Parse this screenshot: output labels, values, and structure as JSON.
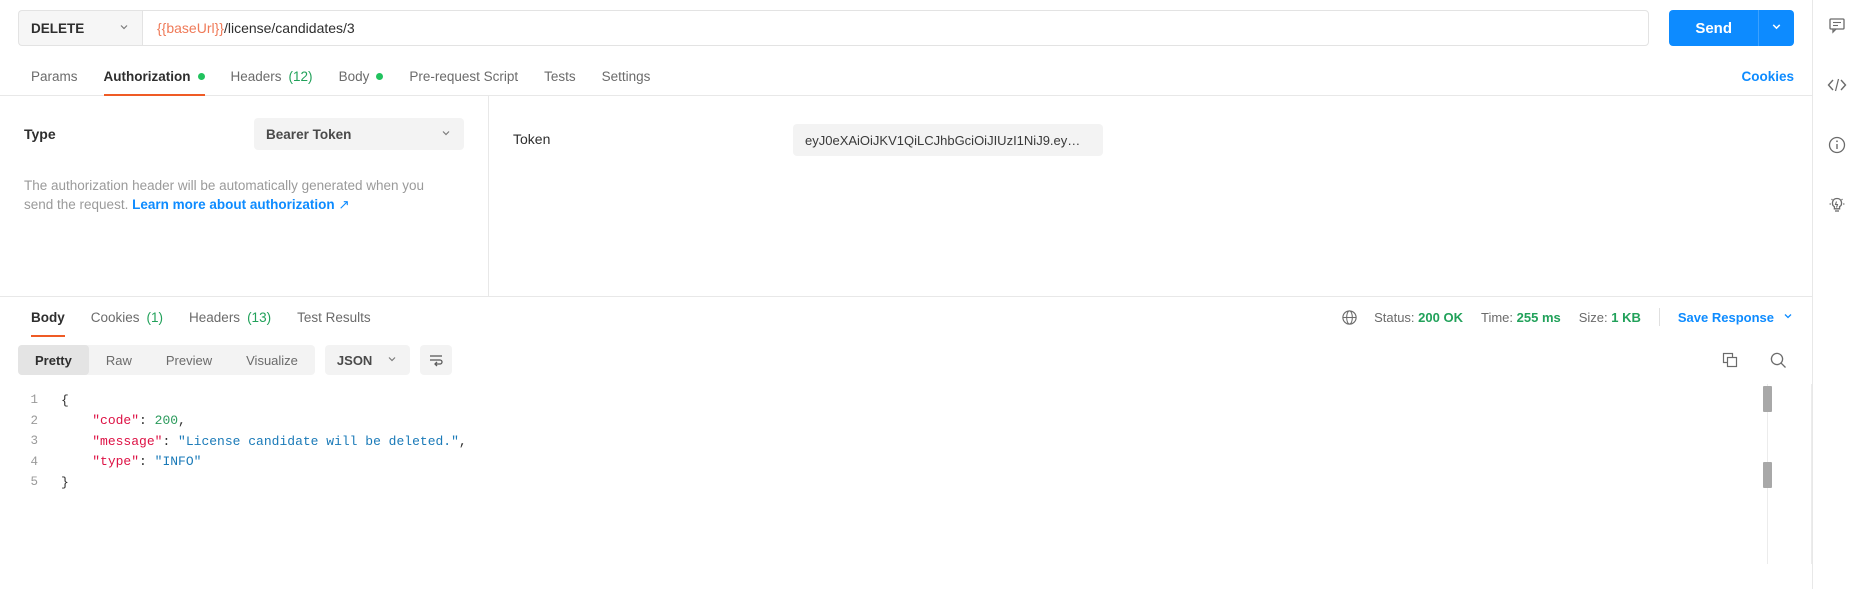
{
  "request": {
    "method": "DELETE",
    "url_variable": "{{baseUrl}}",
    "url_path": "/license/candidates/3",
    "send_label": "Send",
    "send_caret_icon": "chevron-down-icon",
    "method_caret_icon": "chevron-down-icon"
  },
  "request_tabs": {
    "items": [
      {
        "label": "Params",
        "active": false,
        "dot": false,
        "count": ""
      },
      {
        "label": "Authorization",
        "active": true,
        "dot": true,
        "count": ""
      },
      {
        "label": "Headers",
        "active": false,
        "dot": false,
        "count": "(12)"
      },
      {
        "label": "Body",
        "active": false,
        "dot": true,
        "count": ""
      },
      {
        "label": "Pre-request Script",
        "active": false,
        "dot": false,
        "count": ""
      },
      {
        "label": "Tests",
        "active": false,
        "dot": false,
        "count": ""
      },
      {
        "label": "Settings",
        "active": false,
        "dot": false,
        "count": ""
      }
    ],
    "cookies_link": "Cookies"
  },
  "authorization": {
    "type_label": "Type",
    "type_value": "Bearer Token",
    "type_caret_icon": "chevron-down-icon",
    "help_text": "The authorization header will be automatically generated when you send the request.",
    "help_link": "Learn more about authorization",
    "help_link_icon": "external-link-icon",
    "token_label": "Token",
    "token_value": "eyJ0eXAiOiJKV1QiLCJhbGciOiJIUzI1NiJ9.ey…"
  },
  "response_tabs": {
    "items": [
      {
        "label": "Body",
        "active": true,
        "count": ""
      },
      {
        "label": "Cookies",
        "active": false,
        "count": "(1)"
      },
      {
        "label": "Headers",
        "active": false,
        "count": "(13)"
      },
      {
        "label": "Test Results",
        "active": false,
        "count": ""
      }
    ],
    "globe_icon": "globe-icon",
    "status_label": "Status:",
    "status_value": "200 OK",
    "time_label": "Time:",
    "time_value": "255 ms",
    "size_label": "Size:",
    "size_value": "1 KB",
    "save_response_label": "Save Response",
    "save_response_caret_icon": "chevron-down-icon"
  },
  "body_toolbar": {
    "views": [
      {
        "label": "Pretty",
        "active": true
      },
      {
        "label": "Raw",
        "active": false
      },
      {
        "label": "Preview",
        "active": false
      },
      {
        "label": "Visualize",
        "active": false
      }
    ],
    "format": "JSON",
    "format_caret_icon": "chevron-down-icon",
    "wrap_icon": "word-wrap-icon",
    "copy_icon": "copy-icon",
    "search_icon": "search-icon"
  },
  "response_body": {
    "lines": [
      {
        "num": "1",
        "tokens": [
          {
            "t": "p",
            "v": "{"
          }
        ]
      },
      {
        "num": "2",
        "tokens": [
          {
            "t": "p",
            "v": "    "
          },
          {
            "t": "k",
            "v": "\"code\""
          },
          {
            "t": "p",
            "v": ": "
          },
          {
            "t": "n",
            "v": "200"
          },
          {
            "t": "p",
            "v": ","
          }
        ]
      },
      {
        "num": "3",
        "tokens": [
          {
            "t": "p",
            "v": "    "
          },
          {
            "t": "k",
            "v": "\"message\""
          },
          {
            "t": "p",
            "v": ": "
          },
          {
            "t": "s",
            "v": "\"License candidate will be deleted.\""
          },
          {
            "t": "p",
            "v": ","
          }
        ]
      },
      {
        "num": "4",
        "tokens": [
          {
            "t": "p",
            "v": "    "
          },
          {
            "t": "k",
            "v": "\"type\""
          },
          {
            "t": "p",
            "v": ": "
          },
          {
            "t": "s",
            "v": "\"INFO\""
          }
        ]
      },
      {
        "num": "5",
        "tokens": [
          {
            "t": "p",
            "v": "}"
          }
        ]
      }
    ]
  },
  "right_rail": {
    "items": [
      {
        "icon": "comment-icon"
      },
      {
        "icon": "code-icon"
      },
      {
        "icon": "info-icon"
      },
      {
        "icon": "bulb-icon"
      }
    ]
  },
  "colors": {
    "accent_orange": "#ef5b25",
    "link_blue": "#0d8bff",
    "status_green": "#21a15a",
    "variable_orange": "#ef7a58"
  }
}
